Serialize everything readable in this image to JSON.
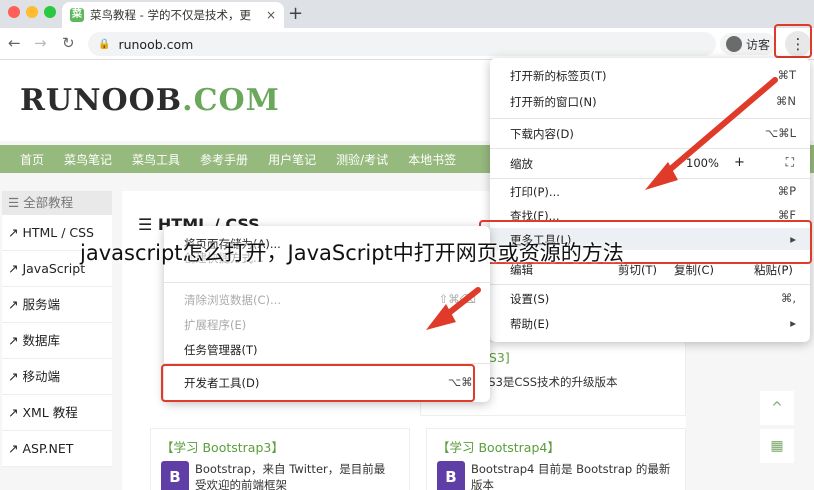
{
  "browser": {
    "tab_title": "菜鸟教程 - 学的不仅是技术，更",
    "tab_favicon": "菜",
    "tab_close": "×",
    "new_tab": "+",
    "back": "←",
    "forward": "→",
    "reload": "↻",
    "lock": "🔒",
    "url": "runoob.com",
    "profile_label": "访客",
    "menu_button": "⋮"
  },
  "page": {
    "logo_main": "RUNOOB",
    "logo_suffix": ".COM",
    "nav": [
      "首页",
      "菜鸟笔记",
      "菜鸟工具",
      "参考手册",
      "用户笔记",
      "测验/考试",
      "本地书签"
    ],
    "sidebar_head": "☰ 全部教程",
    "sidebar": [
      "HTML / CSS",
      "JavaScript",
      "服务端",
      "数据库",
      "移动端",
      "XML 教程",
      "ASP.NET"
    ],
    "section_title": "☰ HTML / CSS",
    "cards": [
      {
        "title": "SS3]",
        "desc": "SS3是CSS技术的升级版本",
        "icon": ""
      },
      {
        "title": "【学习 Bootstrap3】",
        "desc": "Bootstrap，来自 Twitter，是目前最受欢迎的前端框架",
        "icon": "B"
      },
      {
        "title": "【学习 Bootstrap4】",
        "desc": "Bootstrap4 目前是 Bootstrap 的最新版本",
        "icon": "B"
      }
    ],
    "tools": [
      "^",
      "▦"
    ]
  },
  "chrome_menu": {
    "new_tab": {
      "label": "打开新的标签页(T)",
      "key": "⌘T"
    },
    "new_window": {
      "label": "打开新的窗口(N)",
      "key": "⌘N"
    },
    "downloads": {
      "label": "下载内容(D)",
      "key": "⌥⌘L"
    },
    "zoom": {
      "label": "缩放",
      "minus": "-",
      "value": "100%",
      "plus": "+",
      "fullscreen": "⛶"
    },
    "print": {
      "label": "打印(P)...",
      "key": "⌘P"
    },
    "find": {
      "label": "查找(F)...",
      "key": "⌘F"
    },
    "more_tools": {
      "label": "更多工具(L)",
      "arrow": "▸"
    },
    "edit": {
      "label": "编辑",
      "cut": "剪切(T)",
      "copy": "复制(C)",
      "paste": "粘贴(P)"
    },
    "settings": {
      "label": "设置(S)",
      "key": "⌘,"
    },
    "help": {
      "label": "帮助(E)",
      "arrow": "▸"
    }
  },
  "more_tools_menu": {
    "save_page": {
      "label": "将页面存储为(A)...",
      "key": ""
    },
    "create_shortcut": {
      "label": "创建快捷方式...",
      "key": ""
    },
    "clear_data": {
      "label": "清除浏览数据(C)...",
      "key": "⇧⌘⌫"
    },
    "extensions": {
      "label": "扩展程序(E)",
      "key": ""
    },
    "task_manager": {
      "label": "任务管理器(T)",
      "key": ""
    },
    "dev_tools": {
      "label": "开发者工具(D)",
      "key": "⌥⌘I"
    }
  },
  "caption": "javascript怎么打开，JavaScript中打开网页或资源的方法",
  "colors": {
    "highlight": "#e03a2a",
    "nav_green": "#96b97d"
  }
}
